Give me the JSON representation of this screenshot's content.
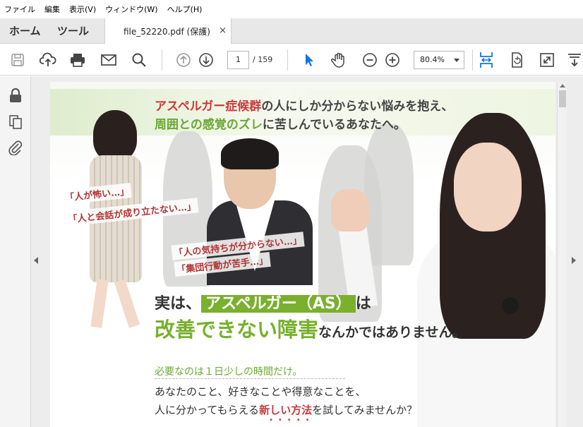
{
  "menubar": {
    "items": [
      "ファイル",
      "編集",
      "表示(V)",
      "ウィンドウ(W)",
      "ヘルプ(H)"
    ]
  },
  "tabs": {
    "home": "ホーム",
    "tools": "ツール",
    "document": "file_52220.pdf (保護)",
    "close": "×"
  },
  "toolbar": {
    "page_current": "1",
    "page_total": "/ 159",
    "zoom": "80.4%",
    "icons": [
      "save-icon",
      "cloud-upload-icon",
      "print-icon",
      "email-icon",
      "search-icon",
      "page-up-icon",
      "page-down-icon",
      "select-cursor-icon",
      "hand-icon",
      "zoom-out-icon",
      "zoom-in-icon",
      "fit-width-icon",
      "rotate-icon",
      "fullscreen-icon",
      "more-tools-icon"
    ]
  },
  "left_panel": {
    "icons": [
      "lock-icon",
      "copy-pages-icon",
      "attachment-icon"
    ]
  },
  "page": {
    "headline1_red": "アスペルガー症候群",
    "headline1_rest": "の人にしか分からない悩みを抱え、",
    "headline2_green": "周囲との感覚のズレ",
    "headline2_rest": "に苦しんでいるあなたへ。",
    "quote1": "「人が怖い…」",
    "quote2": "「人と会話が成り立たない…」",
    "quote3": "「人の気持ちが分からない…」",
    "quote4": "「集団行動が苦手…」",
    "main1_pre": "実は、",
    "main1_box": "アスペルガー（AS）",
    "main1_post": "は",
    "main2_green": "改善できない障害",
    "main2_rest": "なんかではありません。",
    "sub1": "必要なのは１日少しの時間だけ。",
    "sub2": "あなたのこと、好きなことや得意なことを、",
    "sub3_pre": "人に分かってもらえる",
    "sub3_hl": "新しい方法",
    "sub3_post": "を試してみませんか？",
    "dots": "•••••"
  },
  "colors": {
    "accent_blue": "#1473e6",
    "green": "#76b12c",
    "red": "#c83a3a"
  }
}
